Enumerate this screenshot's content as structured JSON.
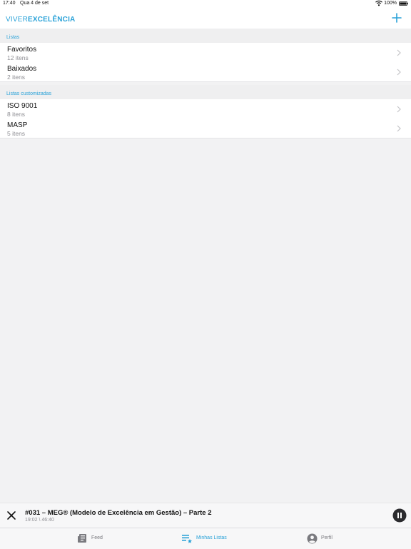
{
  "status_bar": {
    "time": "17:40",
    "date": "Qua 4 de set",
    "battery": "100%"
  },
  "header": {
    "logo_part1": "VIVER",
    "logo_part2": "EXCELÊNCIA",
    "add_icon": "plus-icon"
  },
  "sections": [
    {
      "title": "Listas",
      "items": [
        {
          "label": "Favoritos",
          "count": "12 itens"
        },
        {
          "label": "Baixados",
          "count": "2 itens"
        }
      ]
    },
    {
      "title": "Listas customizadas",
      "items": [
        {
          "label": "ISO 9001",
          "count": "8 itens"
        },
        {
          "label": "MASP",
          "count": "5 itens"
        }
      ]
    }
  ],
  "player": {
    "title": "#031 – MEG® (Modelo de Excelência em Gestão) – Parte 2",
    "time": "19:02 \\ 46:40",
    "state": "playing"
  },
  "tabs": [
    {
      "label": "Feed",
      "icon": "feed-icon",
      "active": false
    },
    {
      "label": "Minhas Listas",
      "icon": "playlist-star-icon",
      "active": true
    },
    {
      "label": "Perfil",
      "icon": "profile-icon",
      "active": false
    }
  ],
  "colors": {
    "accent": "#2aa2d8",
    "background": "#f2f2f3",
    "secondary_text": "#8e8e93"
  }
}
